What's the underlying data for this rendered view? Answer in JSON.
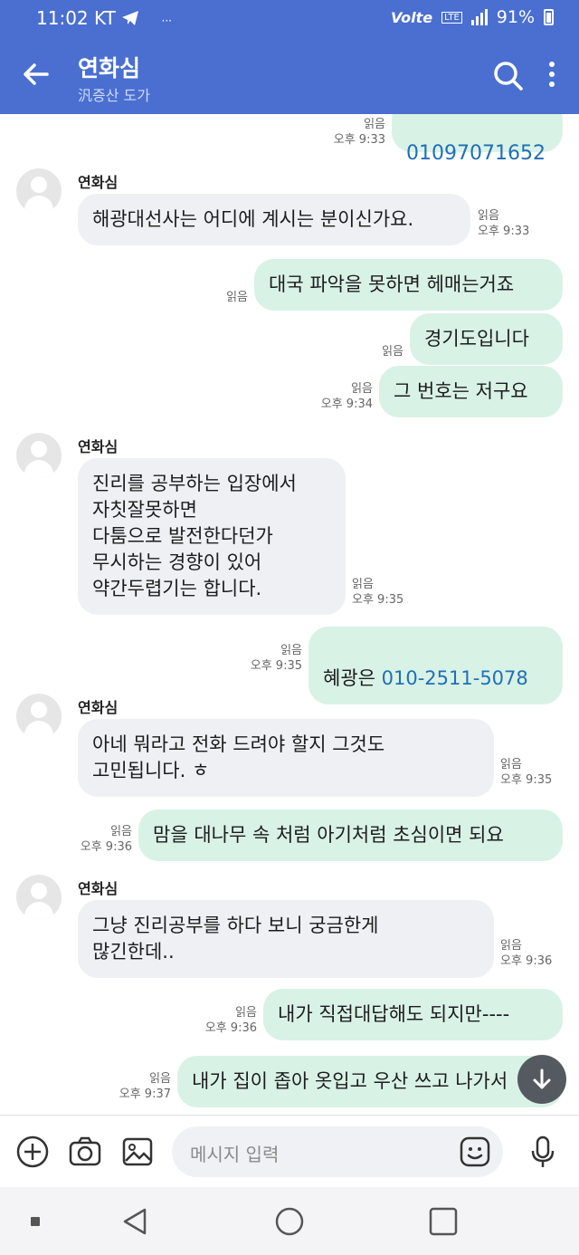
{
  "status": {
    "time": "11:02",
    "carrier": "KT",
    "network": "Volte",
    "lte": "LTE",
    "battery": "91%"
  },
  "header": {
    "title": "연화심",
    "subtitle": "汎증산 도가",
    "back_icon": "back-arrow-icon",
    "search_icon": "search-icon",
    "more_icon": "more-vertical-icon"
  },
  "messages": [
    {
      "dir": "out",
      "text": "01097071652",
      "read": "읽음",
      "time": "오후 9:33"
    },
    {
      "dir": "in",
      "sender": "연화심",
      "text": "해광대선사는 어디에 계시는 분이신가요.",
      "read": "읽음",
      "time": "오후 9:33"
    },
    {
      "dir": "out",
      "text": "대국 파악을 못하면 헤매는거죠",
      "read": "읽음",
      "time": ""
    },
    {
      "dir": "out",
      "text": "경기도입니다",
      "read": "읽음",
      "time": ""
    },
    {
      "dir": "out",
      "text": "그 번호는 저구요",
      "read": "읽음",
      "time": "오후 9:34"
    },
    {
      "dir": "in",
      "sender": "연화심",
      "text": "진리를 공부하는 입장에서\n자칫잘못하면\n다툼으로 발전한다던가\n무시하는 경향이 있어\n약간두렵기는 합니다.",
      "read": "읽음",
      "time": "오후 9:35"
    },
    {
      "dir": "out",
      "text_prefix": "혜광은 ",
      "link": "010-2511-5078",
      "read": "읽음",
      "time": "오후 9:35"
    },
    {
      "dir": "in",
      "sender": "연화심",
      "text": "아네 뭐라고 전화 드려야 할지 그것도\n고민됩니다. ㅎ",
      "read": "읽음",
      "time": "오후 9:35"
    },
    {
      "dir": "out",
      "text": "맘을 대나무 속 처럼 아기처럼 초심이면 되요",
      "read": "읽음",
      "time": "오후 9:36"
    },
    {
      "dir": "in",
      "sender": "연화심",
      "text": "그냥 진리공부를 하다 보니 궁금한게\n많긴한데..",
      "read": "읽음",
      "time": "오후 9:36"
    },
    {
      "dir": "out",
      "text": "내가 직접대답해도 되지만----",
      "read": "읽음",
      "time": "오후 9:36"
    },
    {
      "dir": "out",
      "text": "내가 집이 좁아 옷입고 우산 쓰고 나가서",
      "read": "읽음",
      "time": "오후 9:37"
    }
  ],
  "input": {
    "placeholder": "메시지 입력",
    "icons": [
      "add-icon",
      "camera-icon",
      "gallery-icon",
      "emoji-icon",
      "microphone-icon"
    ]
  },
  "scroll_button_icon": "arrow-down-icon",
  "nav": {
    "icons": [
      "recent-apps-icon",
      "back-triangle-icon",
      "home-circle-icon",
      "overview-square-icon"
    ]
  }
}
